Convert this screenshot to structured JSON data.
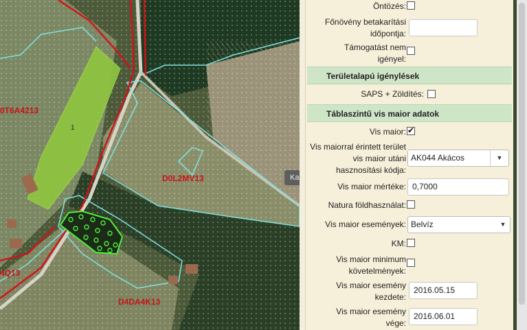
{
  "map": {
    "parcels": [
      {
        "id": "p1",
        "label": "0T6A4213"
      },
      {
        "id": "p2",
        "label": "D0L2MV13"
      },
      {
        "id": "p3",
        "label": "4Q13"
      },
      {
        "id": "p4",
        "label": "D4DA4K13"
      }
    ],
    "field_number": "1",
    "tooltip": "Ka"
  },
  "panel": {
    "rows": {
      "ontozes": {
        "label": "Öntözés:",
        "checked": false
      },
      "fonoveny": {
        "label": "Főnövény betakarítási időpontja:",
        "value": ""
      },
      "tamogatas": {
        "label": "Támogatást nem igényel:",
        "checked": false
      }
    },
    "section_terulet": "Területalapú igénylések",
    "saps": {
      "label": "SAPS + Zöldítés:",
      "checked": false
    },
    "section_vis": "Táblaszintű vis maior adatok",
    "vis_maior": {
      "label": "Vis maior:",
      "checked": true
    },
    "vis_kod": {
      "label": "Vis maiorral érintett terület vis maior utáni hasznosítási kódja:",
      "value": "AK044 Akácos"
    },
    "vis_mertek": {
      "label": "Vis maior mértéke:",
      "value": "0,7000"
    },
    "natura": {
      "label": "Natura földhasználat:",
      "checked": false
    },
    "esemenyek": {
      "label": "Vis maior események:",
      "value": "Belvíz"
    },
    "km": {
      "label": "KM:",
      "checked": false
    },
    "minimum": {
      "label": "Vis maior minimum követelmények:",
      "checked": false
    },
    "kezdete": {
      "label": "Vis maior esemény kezdete:",
      "value": "2016.05.15"
    },
    "vege": {
      "label": "Vis maior esemény vége:",
      "value": "2016.06.01"
    }
  },
  "colors": {
    "parcel_border": "#d4121b",
    "block_border": "#7fe0dd",
    "selected_field": "#8fc640",
    "panel_bg": "#f6efd9",
    "section_bg": "#cfe5c8"
  }
}
